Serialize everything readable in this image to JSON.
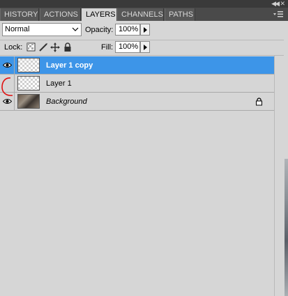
{
  "tabs": [
    {
      "label": "HISTORY"
    },
    {
      "label": "ACTIONS"
    },
    {
      "label": "LAYERS",
      "active": true
    },
    {
      "label": "CHANNELS"
    },
    {
      "label": "PATHS"
    }
  ],
  "blend_mode": {
    "value": "Normal"
  },
  "opacity": {
    "label": "Opacity:",
    "value": "100%"
  },
  "lock": {
    "label": "Lock:"
  },
  "fill": {
    "label": "Fill:",
    "value": "100%"
  },
  "layers": [
    {
      "name": "Layer 1 copy",
      "visible": true,
      "selected": true,
      "thumbnail": "transparent-checker"
    },
    {
      "name": "Layer 1",
      "visible": false,
      "selected": false,
      "thumbnail": "transparent-checker"
    },
    {
      "name": "Background",
      "visible": true,
      "selected": false,
      "thumbnail": "photo",
      "locked": true
    }
  ],
  "colors": {
    "selection": "#3d95e8",
    "panel": "#d6d6d6",
    "tab_bar": "#4a4a4a",
    "annotation": "#e01010"
  }
}
